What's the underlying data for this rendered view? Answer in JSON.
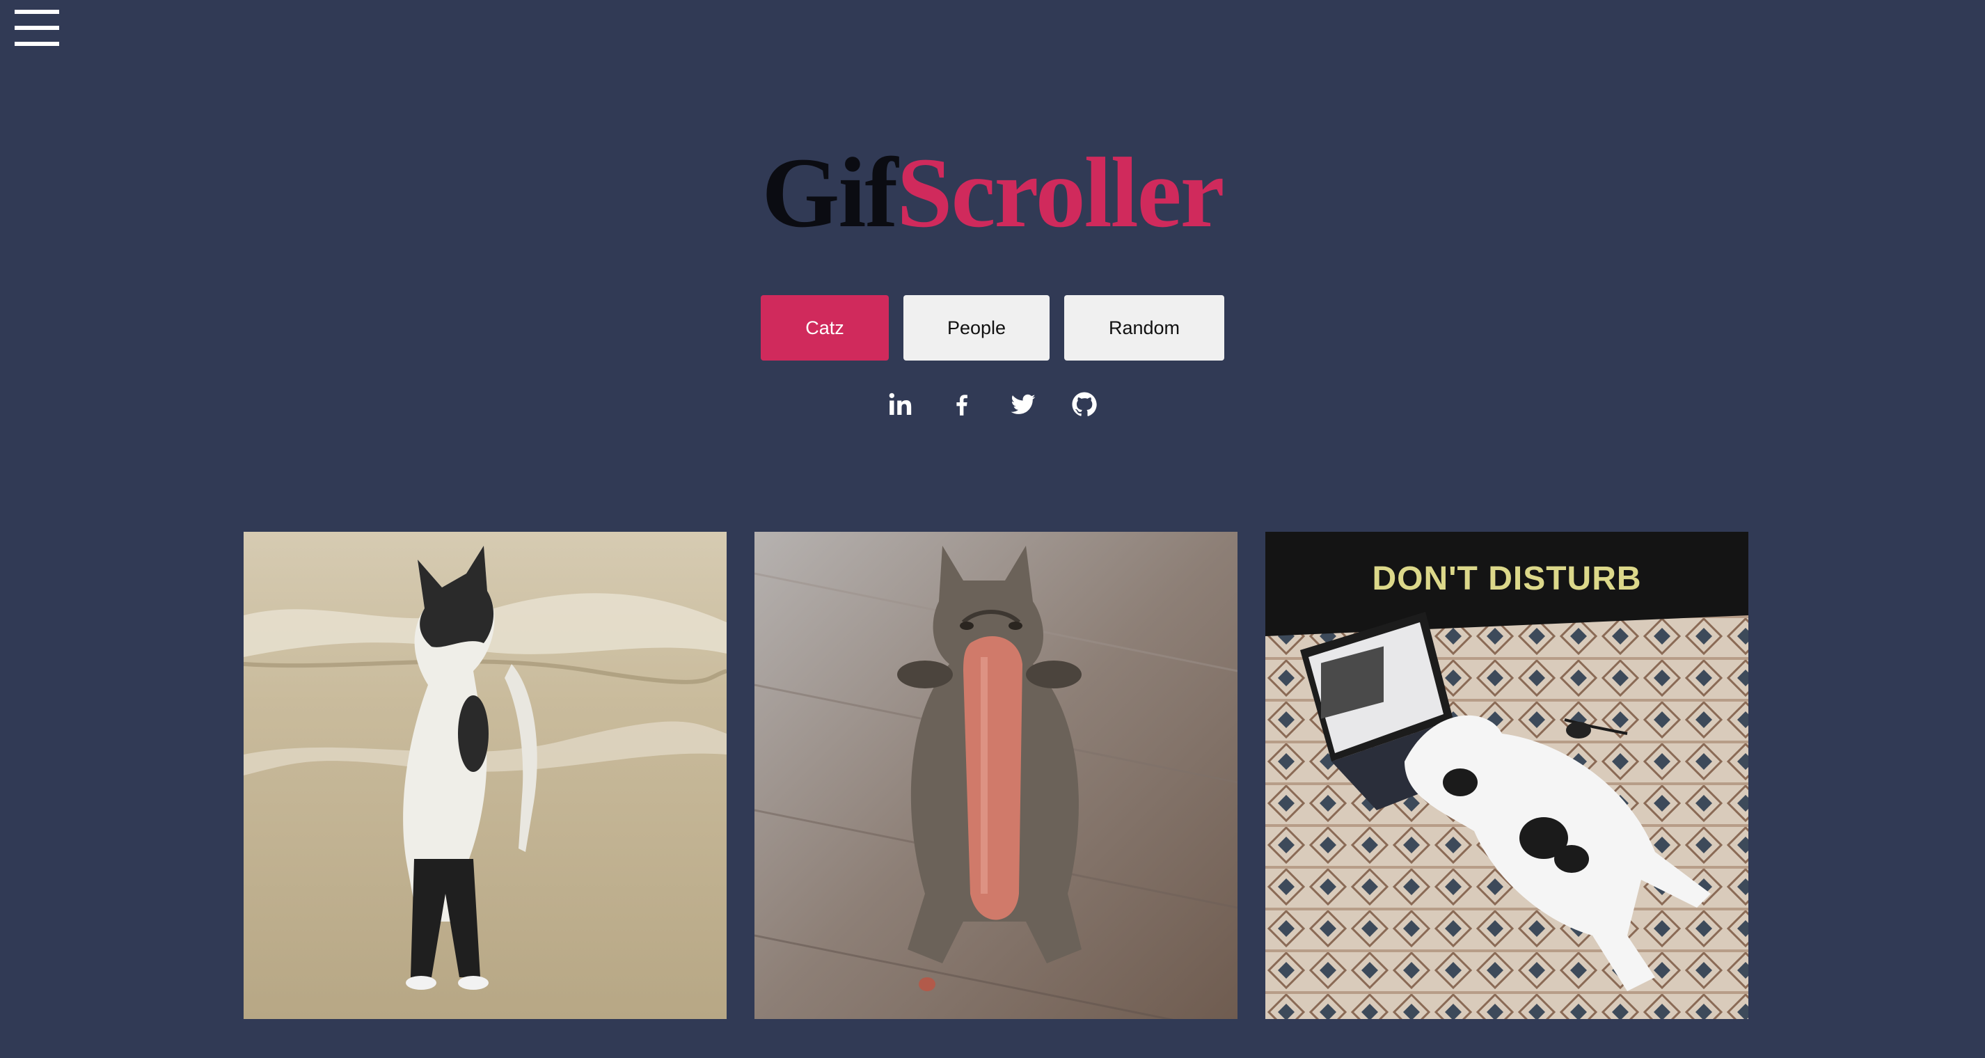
{
  "header": {
    "menu_icon": "hamburger-menu-icon",
    "title_part1": "Gif",
    "title_part2": "Scroller"
  },
  "categories": {
    "catz": "Catz",
    "people": "People",
    "random": "Random",
    "active": "Catz"
  },
  "social": [
    "linkedin-icon",
    "facebook-icon",
    "twitter-icon",
    "github-icon"
  ],
  "gifs": [
    {
      "subject": "cat standing on hind legs at a beach",
      "caption": ""
    },
    {
      "subject": "cat lying on back hugging a sausage",
      "caption": ""
    },
    {
      "subject": "cat next to a laptop on a patterned rug",
      "caption": "DON'T DISTURB"
    }
  ],
  "colors": {
    "background": "#313a55",
    "accent": "#d02a5c",
    "title_dark": "#0b0c12",
    "button_bg": "#f0f0f0"
  }
}
